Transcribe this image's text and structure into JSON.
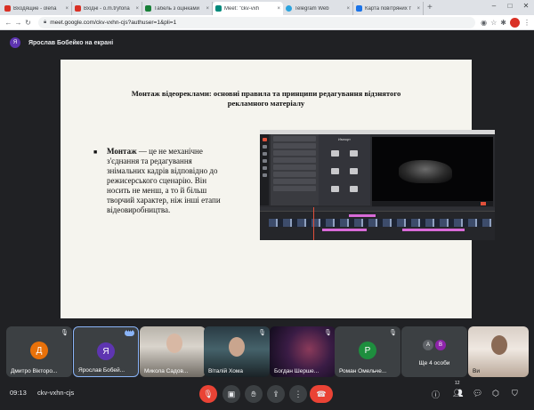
{
  "browser": {
    "tabs": [
      {
        "label": "Входящие - olena",
        "color": "#d93025"
      },
      {
        "label": "Вхідні - o.m.tryfona",
        "color": "#d93025"
      },
      {
        "label": "Табель з оцінками",
        "color": "#188038"
      },
      {
        "label": "Meet: \"ckv-vxh",
        "color": "#00897b"
      },
      {
        "label": "Telegram Web",
        "color": "#2aa3de"
      },
      {
        "label": "Карта повітряних т",
        "color": "#1a73e8"
      }
    ],
    "url": "meet.google.com/ckv-vxhn-cjs?authuser=1&pli=1",
    "profile_color": "#d93025"
  },
  "presenter": {
    "initial": "Я",
    "label": "Ярослав Бобейко на екрані"
  },
  "slide": {
    "title_line1": "Монтаж відеореклами: основні правила та принципи редагування відзнятого",
    "title_line2": "рекламного матеріалу",
    "bullet": "■",
    "term": "Монтаж",
    "body": " — це не механічне з'єднання та редагування знімальних кадрів відповідно до режисерського сценарію. Він носить не менш, а то й більш творчий характер, ніж інші етапи відеовиробництва.",
    "screenshot_header": "Импорт"
  },
  "participants": [
    {
      "name": "Дмитро Вікторо...",
      "initial": "Д",
      "color": "#e8710a",
      "type": "avatar"
    },
    {
      "name": "Ярослав Бобей...",
      "initial": "Я",
      "color": "#5e35b1",
      "type": "avatar",
      "selected": true
    },
    {
      "name": "Микола Садов...",
      "type": "photo"
    },
    {
      "name": "Віталій Хома",
      "type": "photo"
    },
    {
      "name": "Богдан Шерше...",
      "type": "photo"
    },
    {
      "name": "Роман Омельче...",
      "initial": "Р",
      "color": "#1e8e3e",
      "type": "avatar"
    },
    {
      "name": "Ще 4 особи",
      "type": "group",
      "initials": [
        "А",
        "В"
      ]
    },
    {
      "name": "Ви",
      "type": "photo"
    }
  ],
  "bottom": {
    "time": "09:13",
    "meeting_code": "ckv-vxhn-cjs",
    "people_count": "12"
  }
}
